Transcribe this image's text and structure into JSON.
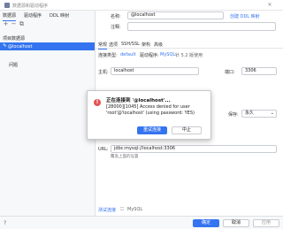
{
  "window": {
    "title": "数据源和驱动程序"
  },
  "left": {
    "tabs": [
      "数据源",
      "驱动程序",
      "DDL 映射"
    ],
    "section_project": "项目数据源",
    "selected_item": "@localhost",
    "section_problems": "问题"
  },
  "right": {
    "name_label": "名称:",
    "name_value": "@localhost",
    "create_ddl_link": "创建 DDL 映射",
    "comment_label": "注释:",
    "tabs": [
      "常规",
      "选项",
      "SSH/SSL",
      "架构",
      "高级"
    ],
    "connection_type_label": "连接类型:",
    "connection_type_value": "default",
    "driver_label": "驱动程序:",
    "driver_value": "MySQL",
    "driver_version": "针 5.2 版使用",
    "host_label": "主机:",
    "host_value": "localhost",
    "port_label": "端口:",
    "port_value": "3306",
    "save_label": "保存:",
    "save_value": "永久",
    "url_label": "URL:",
    "url_value": "jdbc:mysql://localhost:3306",
    "url_hint": "覆盖上面的设置",
    "test_connection": "测试连接",
    "test_driver": "MySQL"
  },
  "dialog": {
    "title": "正在连接到 '@localhost'...",
    "message": "[28000][1045] Access denied for user 'root'@'localhost' (using password: YES)",
    "retry_button": "重试连接",
    "abort_button": "中止"
  },
  "bottom": {
    "ok_button": "确定",
    "cancel_button": "取消",
    "apply_button": "应用"
  }
}
